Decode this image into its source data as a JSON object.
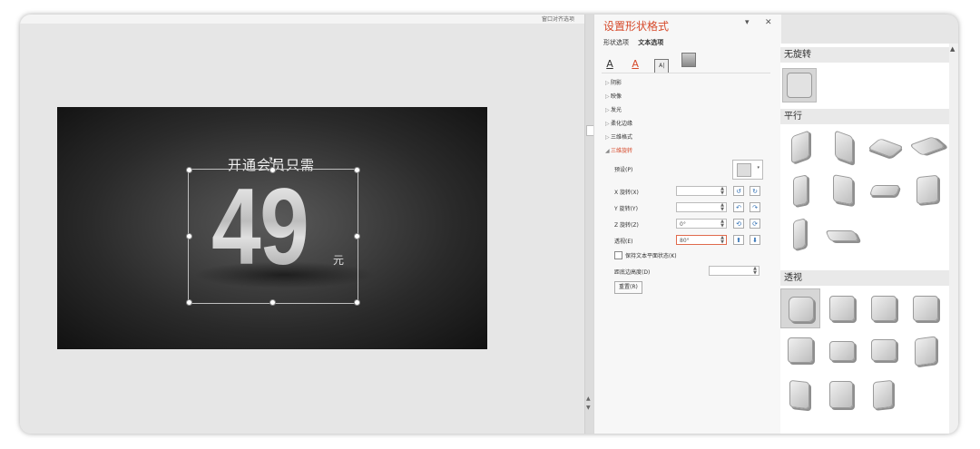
{
  "window": {
    "top_strip_label": "窗口对齐选项"
  },
  "slide": {
    "headline": "开通会员只需",
    "number": "49",
    "unit": "元",
    "rotation_handle": "↻"
  },
  "panel": {
    "title": "设置形状格式",
    "dropdown_glyph": "▾",
    "close_glyph": "✕",
    "tabs": [
      "形状选项",
      "文本选项"
    ],
    "icons": [
      "text-fill-icon",
      "text-outline-icon",
      "text-box-icon",
      "picture-icon"
    ],
    "icon_glyphs": {
      "fill": "A",
      "outline": "A",
      "box": "A|"
    },
    "sections": [
      {
        "label": "阴影",
        "open": false
      },
      {
        "label": "映像",
        "open": false
      },
      {
        "label": "发光",
        "open": false
      },
      {
        "label": "柔化边缘",
        "open": false
      },
      {
        "label": "三维格式",
        "open": false
      },
      {
        "label": "三维旋转",
        "open": true
      }
    ],
    "rotation": {
      "preset_label": "预设(P)",
      "x_label": "X 旋转(X)",
      "x_value": "",
      "y_label": "Y 旋转(Y)",
      "y_value": "",
      "z_label": "Z 旋转(Z)",
      "z_value": "0°",
      "persp_label": "透视(E)",
      "persp_value": "80°",
      "keep_flat_label": "保持文本平面状态(K)",
      "distance_label": "距底边高度(D)",
      "distance_value": "",
      "reset_label": "重置(R)"
    }
  },
  "gallery": {
    "groups": [
      "无旋转",
      "平行",
      "透视"
    ],
    "scroll_up": "▲"
  },
  "colors": {
    "accent": "#d64a2b",
    "frame": "#e6e6e6"
  }
}
